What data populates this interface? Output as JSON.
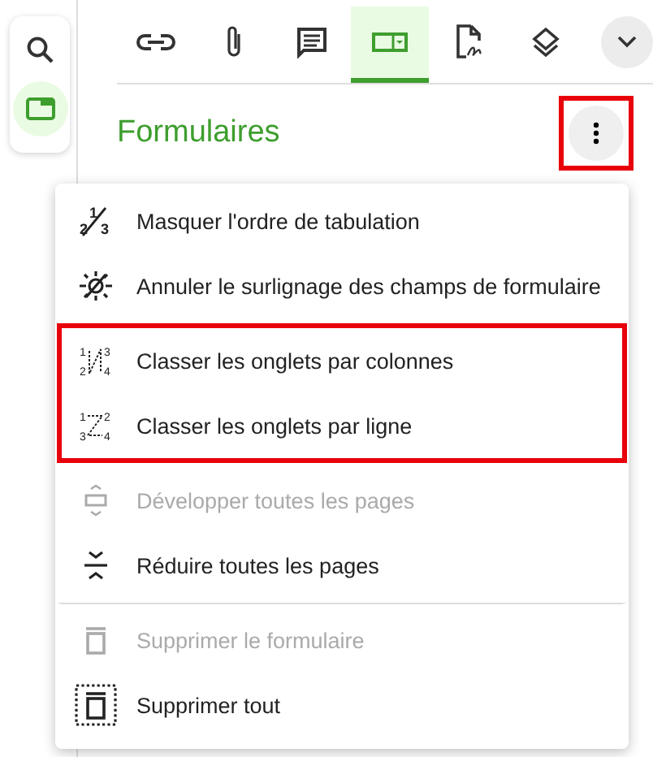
{
  "sidebar": {
    "items": [
      {
        "selected": false
      },
      {
        "selected": true
      }
    ]
  },
  "toolbar": {
    "tabs": [
      {
        "selected": false
      },
      {
        "selected": false
      },
      {
        "selected": false
      },
      {
        "selected": true
      },
      {
        "selected": false
      },
      {
        "selected": false
      }
    ]
  },
  "panel": {
    "title": "Formulaires",
    "more_highlighted": true
  },
  "menu": {
    "sections": [
      {
        "highlighted": false,
        "separated": false,
        "items": [
          {
            "label": "Masquer l'ordre de tabulation",
            "disabled": false,
            "icon_digits": [
              "1",
              "2",
              "3"
            ]
          },
          {
            "label": "Annuler le surlignage des champs de formulaire",
            "disabled": false
          }
        ]
      },
      {
        "highlighted": true,
        "separated": false,
        "items": [
          {
            "label": "Classer les onglets par colonnes",
            "disabled": false,
            "icon_digits": [
              "1",
              "2",
              "3",
              "4"
            ]
          },
          {
            "label": "Classer les onglets par ligne",
            "disabled": false,
            "icon_digits": [
              "1",
              "2",
              "3",
              "4"
            ]
          }
        ]
      },
      {
        "highlighted": false,
        "separated": false,
        "items": [
          {
            "label": "Développer toutes les pages",
            "disabled": true
          },
          {
            "label": "Réduire toutes les pages",
            "disabled": false
          }
        ]
      },
      {
        "highlighted": false,
        "separated": true,
        "items": [
          {
            "label": "Supprimer le formulaire",
            "disabled": true
          },
          {
            "label": "Supprimer tout",
            "disabled": false
          }
        ]
      }
    ]
  }
}
